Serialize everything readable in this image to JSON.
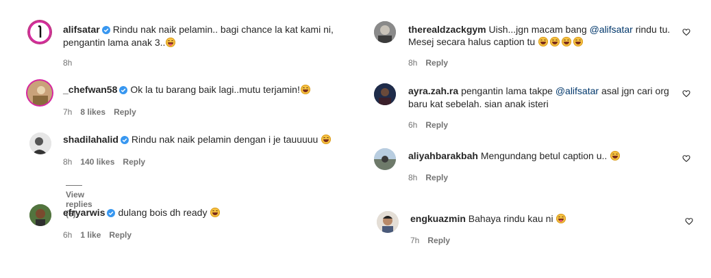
{
  "left": [
    {
      "username": "alifsatar",
      "verified": true,
      "line1": "Rindu nak naik pelamin.. bagi chance la kat kami ni,",
      "line2": "pengantin lama anak 3..",
      "emoji_line2": "tongue",
      "time": "8h",
      "likes": "",
      "reply": ""
    },
    {
      "username": "_chefwan58",
      "verified": true,
      "line1": "Ok la tu barang baik lagi..mutu terjamin!",
      "emoji_line1": "grin",
      "time": "7h",
      "likes": "8 likes",
      "reply": "Reply"
    },
    {
      "username": "shadilahalid",
      "verified": true,
      "line1": "Rindu nak naik pelamin dengan i je tauuuuu",
      "emoji_line1": "grin",
      "time": "8h",
      "likes": "140 likes",
      "reply": "Reply",
      "view_replies": "View replies (6)"
    },
    {
      "username": "efryarwis",
      "verified": true,
      "line1": "dulang bois dh ready",
      "emoji_line1": "grin",
      "time": "6h",
      "likes": "1 like",
      "reply": "Reply"
    }
  ],
  "right": [
    {
      "username": "therealdzackgym",
      "line1_pre": "Uish...jgn macam bang ",
      "line1_mention": "@alifsatar",
      "line1_post": " rindu tu.",
      "line2": "Mesej secara halus caption tu",
      "emoji_count_line2": 4,
      "time": "8h",
      "reply": "Reply"
    },
    {
      "username": "ayra.zah.ra",
      "line1_pre": "pengantin lama takpe ",
      "line1_mention": "@alifsatar",
      "line1_post": " asal jgn cari org",
      "line2": "baru kat sebelah. sian anak isteri",
      "time": "6h",
      "reply": "Reply"
    },
    {
      "username": "aliyahbarakbah",
      "line1": "Mengundang betul caption u..",
      "emoji_line1": "grin",
      "time": "8h",
      "reply": "Reply"
    },
    {
      "username": "engkuazmin",
      "line1": "Bahaya rindu kau ni",
      "emoji_line1": "tongue",
      "time": "7h",
      "reply": "Reply"
    }
  ],
  "colors": {
    "verified": "#3897f0",
    "mention": "#00376b",
    "muted": "#737373",
    "text": "#262626"
  }
}
